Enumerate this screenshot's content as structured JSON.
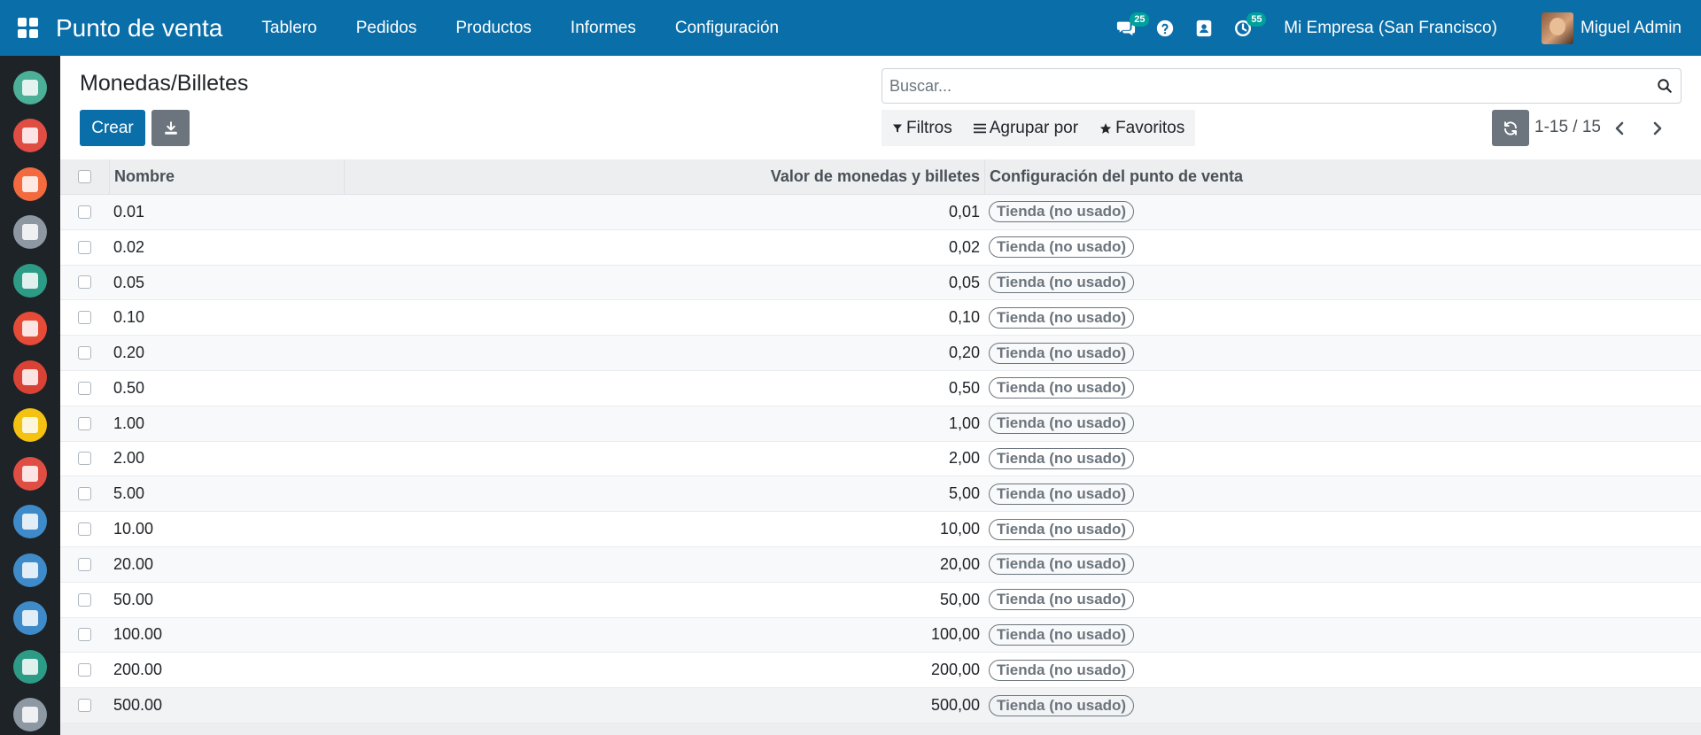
{
  "navbar": {
    "brand": "Punto de venta",
    "menu": [
      "Tablero",
      "Pedidos",
      "Productos",
      "Informes",
      "Configuración"
    ],
    "messages_badge": "25",
    "activities_badge": "55",
    "company": "Mi Empresa (San Francisco)",
    "user": "Miguel Admin"
  },
  "sidebar": {
    "apps": [
      {
        "name": "discuss",
        "color": "#4caf97"
      },
      {
        "name": "calendar",
        "color": "#e04d43"
      },
      {
        "name": "contacts",
        "color": "#f26a3d"
      },
      {
        "name": "crm",
        "color": "#8d98a3"
      },
      {
        "name": "employees",
        "color": "#2d9c86"
      },
      {
        "name": "sales",
        "color": "#e54b36"
      },
      {
        "name": "dashboards",
        "color": "#d94336"
      },
      {
        "name": "point-of-sale",
        "color": "#f4c211"
      },
      {
        "name": "purchase",
        "color": "#e04d43"
      },
      {
        "name": "inventory",
        "color": "#3f8bc9"
      },
      {
        "name": "accounting",
        "color": "#3f8bc9"
      },
      {
        "name": "planning",
        "color": "#3f8bc9"
      },
      {
        "name": "timesheets",
        "color": "#2d9c86"
      },
      {
        "name": "website",
        "color": "#8d98a3"
      }
    ]
  },
  "control": {
    "title": "Monedas/Billetes",
    "search_placeholder": "Buscar...",
    "create_label": "Crear",
    "filters_label": "Filtros",
    "group_label": "Agrupar por",
    "favorites_label": "Favoritos",
    "pager": "1-15 / 15"
  },
  "table": {
    "headers": {
      "name": "Nombre",
      "value": "Valor de monedas y billetes",
      "config": "Configuración del punto de venta"
    },
    "rows": [
      {
        "name": "0.01",
        "value": "0,01",
        "config": "Tienda (no usado)"
      },
      {
        "name": "0.02",
        "value": "0,02",
        "config": "Tienda (no usado)"
      },
      {
        "name": "0.05",
        "value": "0,05",
        "config": "Tienda (no usado)"
      },
      {
        "name": "0.10",
        "value": "0,10",
        "config": "Tienda (no usado)"
      },
      {
        "name": "0.20",
        "value": "0,20",
        "config": "Tienda (no usado)"
      },
      {
        "name": "0.50",
        "value": "0,50",
        "config": "Tienda (no usado)"
      },
      {
        "name": "1.00",
        "value": "1,00",
        "config": "Tienda (no usado)"
      },
      {
        "name": "2.00",
        "value": "2,00",
        "config": "Tienda (no usado)"
      },
      {
        "name": "5.00",
        "value": "5,00",
        "config": "Tienda (no usado)"
      },
      {
        "name": "10.00",
        "value": "10,00",
        "config": "Tienda (no usado)"
      },
      {
        "name": "20.00",
        "value": "20,00",
        "config": "Tienda (no usado)"
      },
      {
        "name": "50.00",
        "value": "50,00",
        "config": "Tienda (no usado)"
      },
      {
        "name": "100.00",
        "value": "100,00",
        "config": "Tienda (no usado)"
      },
      {
        "name": "200.00",
        "value": "200,00",
        "config": "Tienda (no usado)"
      },
      {
        "name": "500.00",
        "value": "500,00",
        "config": "Tienda (no usado)"
      }
    ]
  }
}
